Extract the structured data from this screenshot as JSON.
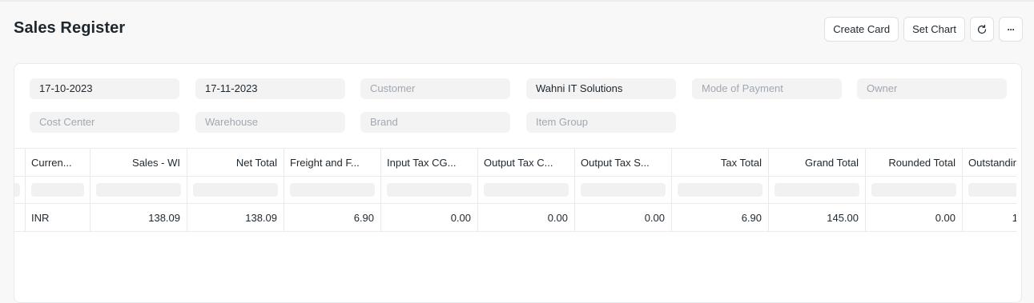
{
  "page": {
    "title": "Sales Register"
  },
  "toolbar": {
    "create_card": "Create Card",
    "set_chart": "Set Chart",
    "refresh_icon": "refresh-icon",
    "more_icon": "ellipsis-icon",
    "more_glyph": "···",
    "refresh_glyph": "⟳"
  },
  "filters": {
    "from_date": "17-10-2023",
    "to_date": "17-11-2023",
    "customer": "Customer",
    "company": "Wahni IT Solutions",
    "mode_of_payment": "Mode of Payment",
    "owner": "Owner",
    "cost_center": "Cost Center",
    "warehouse": "Warehouse",
    "brand": "Brand",
    "item_group": "Item Group"
  },
  "table": {
    "columns": [
      "Curren...",
      "Sales - WI",
      "Net Total",
      "Freight and F...",
      "Input Tax CG...",
      "Output Tax C...",
      "Output Tax S...",
      "Tax Total",
      "Grand Total",
      "Rounded Total",
      "Outstandin"
    ],
    "row": [
      "INR",
      "138.09",
      "138.09",
      "6.90",
      "0.00",
      "0.00",
      "0.00",
      "6.90",
      "145.00",
      "0.00",
      "1"
    ]
  },
  "colors": {
    "background": "#f8f8f8",
    "card": "#ffffff",
    "input": "#f3f3f3",
    "placeholder": "#a1a8b0"
  }
}
